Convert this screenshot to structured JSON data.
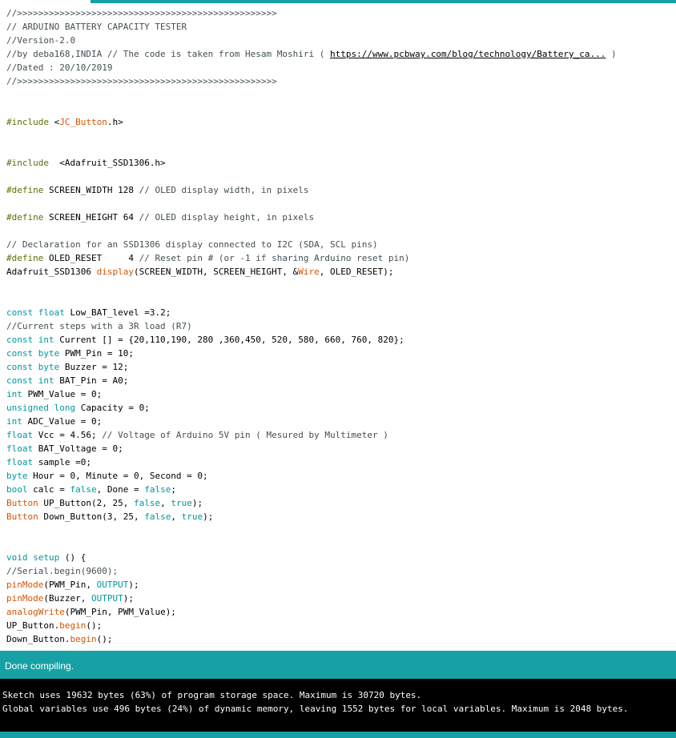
{
  "colors": {
    "accent": "#17a1a5",
    "comment": "#434f54",
    "type_keyword": "#00979c",
    "function_keyword": "#d35400",
    "preprocessor": "#5e6d03",
    "console_bg": "#000000",
    "console_text": "#ffffff"
  },
  "editor": {
    "l1": "//>>>>>>>>>>>>>>>>>>>>>>>>>>>>>>>>>>>>>>>>>>>>>>>>>",
    "l2": "// ARDUINO BATTERY CAPACITY TESTER",
    "l3": "//Version-2.0",
    "l4_pre": "//by deba168,INDIA // The code is taken from Hesam Moshiri ( ",
    "l4_link": "https://www.pcbway.com/blog/technology/Battery_ca...",
    "l4_post": " )",
    "l5": "//Dated : 20/10/2019",
    "l6": "//>>>>>>>>>>>>>>>>>>>>>>>>>>>>>>>>>>>>>>>>>>>>>>>>>",
    "l7_a": "#include",
    "l7_b": " <",
    "l7_c": "JC_Button",
    "l7_d": ".h>",
    "l8_a": "#include",
    "l8_b": "  <Adafruit_SSD1306.h>",
    "l9_a": "#define",
    "l9_b": " SCREEN_WIDTH 128 ",
    "l9_c": "// OLED display width, in pixels",
    "l10_a": "#define",
    "l10_b": " SCREEN_HEIGHT 64 ",
    "l10_c": "// OLED display height, in pixels",
    "l11": "// Declaration for an SSD1306 display connected to I2C (SDA, SCL pins)",
    "l12_a": "#define",
    "l12_b": " OLED_RESET     4 ",
    "l12_c": "// Reset pin # (or -1 if sharing Arduino reset pin)",
    "l13_a": "Adafruit_SSD1306 ",
    "l13_b": "display",
    "l13_c": "(SCREEN_WIDTH, SCREEN_HEIGHT, &",
    "l13_d": "Wire",
    "l13_e": ", OLED_RESET);",
    "l14_a": "const float",
    "l14_b": " Low_BAT_level =3.2;",
    "l15": "//Current steps with a 3R load (R7)",
    "l16_a": "const int",
    "l16_b": " Current [] = {20,110,190, 280 ,360,450, 520, 580, 660, 760, 820};",
    "l17_a": "const byte",
    "l17_b": " PWM_Pin = 10;",
    "l18_a": "const byte",
    "l18_b": " Buzzer = 12;",
    "l19_a": "const int",
    "l19_b": " BAT_Pin = A0;",
    "l20_a": "int",
    "l20_b": " PWM_Value = 0;",
    "l21_a": "unsigned long",
    "l21_b": " Capacity = 0;",
    "l22_a": "int",
    "l22_b": " ADC_Value = 0;",
    "l23_a": "float",
    "l23_b": " Vcc = 4.56; ",
    "l23_c": "// Voltage of Arduino 5V pin ( Mesured by Multimeter )",
    "l24_a": "float",
    "l24_b": " BAT_Voltage = 0;",
    "l25_a": "float",
    "l25_b": " sample =0;",
    "l26_a": "byte",
    "l26_b": " Hour = 0, Minute = 0, Second = 0;",
    "l27_a": "bool",
    "l27_b": " calc = ",
    "l27_c": "false",
    "l27_d": ", Done = ",
    "l27_e": "false",
    "l27_f": ";",
    "l28_a": "Button",
    "l28_b": " UP_Button(2, 25, ",
    "l28_c": "false",
    "l28_d": ", ",
    "l28_e": "true",
    "l28_f": ");",
    "l29_a": "Button",
    "l29_b": " Down_Button(3, 25, ",
    "l29_c": "false",
    "l29_d": ", ",
    "l29_e": "true",
    "l29_f": ");",
    "l30_a": "void",
    "l30_b": " ",
    "l30_c": "setup",
    "l30_d": " () {",
    "l31": "//Serial.begin(9600);",
    "l32_a": "pinMode",
    "l32_b": "(PWM_Pin, ",
    "l32_c": "OUTPUT",
    "l32_d": ");",
    "l33_a": "pinMode",
    "l33_b": "(Buzzer, ",
    "l33_c": "OUTPUT",
    "l33_d": ");",
    "l34_a": "analogWrite",
    "l34_b": "(PWM_Pin, PWM_Value);",
    "l35_a": "UP_Button.",
    "l35_b": "begin",
    "l35_c": "();",
    "l36_a": "Down_Button.",
    "l36_b": "begin",
    "l36_c": "();"
  },
  "status": {
    "message": "Done compiling."
  },
  "console": {
    "line1": "Sketch uses 19632 bytes (63%) of program storage space. Maximum is 30720 bytes.",
    "line2": "Global variables use 496 bytes (24%) of dynamic memory, leaving 1552 bytes for local variables. Maximum is 2048 bytes."
  }
}
